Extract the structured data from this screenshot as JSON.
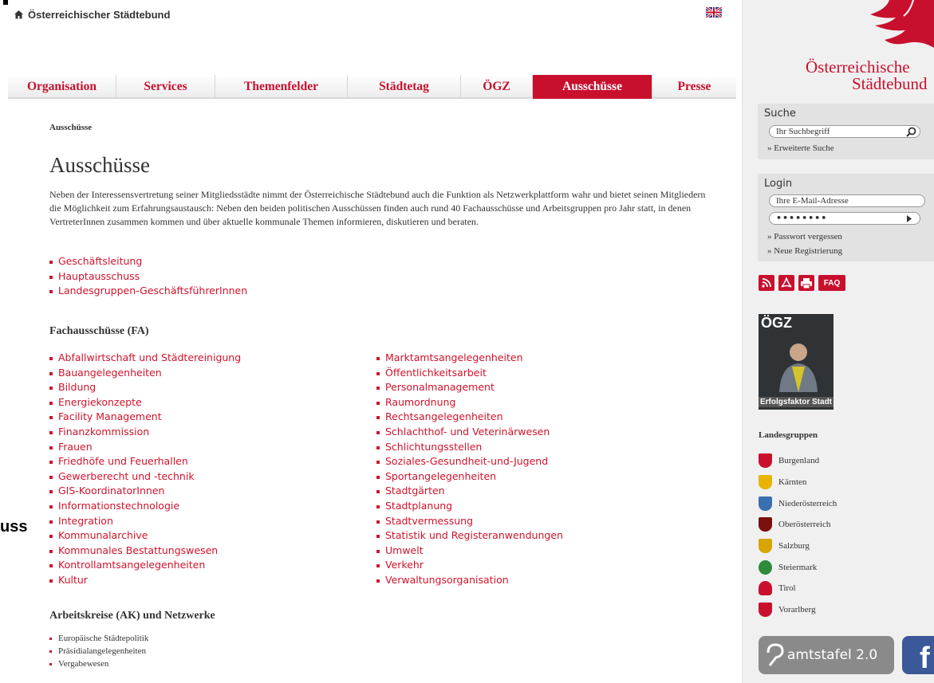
{
  "header": {
    "site_name": "Österreichischer Städtebund",
    "language_icon": "uk-flag-icon"
  },
  "nav": {
    "items": [
      "Organisation",
      "Services",
      "Themenfelder",
      "Städtetag",
      "ÖGZ",
      "Ausschüsse",
      "Presse"
    ],
    "active": "Ausschüsse"
  },
  "edge_fragment": "uss",
  "main": {
    "breadcrumb": "Ausschüsse",
    "title": "Ausschüsse",
    "intro": "Neben der Interessensvertretung seiner Mitgliedsstädte nimmt der Österreichische Städtebund auch die Funktion als Netzwerkplattform wahr und bietet seinen Mitgliedern die Möglichkeit zum Erfahrungsaustausch: Neben den beiden politischen Ausschüssen finden auch rund 40 Fachausschüsse und Arbeitsgruppen pro Jahr statt, in denen VertreterInnen zusammen kommen und über aktuelle kommunale Themen informieren, diskutieren und beraten.",
    "top_links": [
      "Geschäftsleitung",
      "Hauptausschuss",
      "Landesgruppen-GeschäftsführerInnen"
    ],
    "fa_title": "Fachausschüsse (FA)",
    "fa_col1": [
      "Abfallwirtschaft und Städtereinigung",
      "Bauangelegenheiten",
      "Bildung",
      "Energiekonzepte",
      "Facility Management",
      "Finanzkommission",
      "Frauen",
      "Friedhöfe und Feuerhallen",
      "Gewerberecht und -technik",
      "GIS-KoordinatorInnen",
      "Informationstechnologie",
      "Integration",
      "Kommunalarchive",
      "Kommunales Bestattungswesen",
      "Kontrollamtsangelegenheiten",
      "Kultur"
    ],
    "fa_col2": [
      "Marktamtsangelegenheiten",
      "Öffentlichkeitsarbeit",
      "Personalmanagement",
      "Raumordnung",
      "Rechtsangelegenheiten",
      "Schlachthof- und Veterinärwesen",
      "Schlichtungsstellen",
      "Soziales-Gesundheit-und-Jugend",
      "Sportangelegenheiten",
      "Stadtgärten",
      "Stadtplanung",
      "Stadtvermessung",
      "Statistik und Registeranwendungen",
      "Umwelt",
      "Verkehr",
      "Verwaltungsorganisation"
    ],
    "ak_title": "Arbeitskreise (AK) und Netzwerke",
    "ak_list": [
      "Europäische Städtepolitik",
      "Präsidialangelegenheiten",
      "Vergabewesen"
    ]
  },
  "sidebar": {
    "logo_line1": "Österreichische",
    "logo_line2": "Städtebund",
    "search": {
      "title": "Suche",
      "placeholder": "Ihr Suchbegriff",
      "advanced": "Erweiterte Suche"
    },
    "login": {
      "title": "Login",
      "email_placeholder": "Ihre E-Mail-Adresse",
      "password_mask": "••••••••",
      "forgot": "Passwort vergessen",
      "register": "Neue Registrierung"
    },
    "icons": [
      "rss-icon",
      "pdf-icon",
      "print-icon",
      "FAQ"
    ],
    "magazine": {
      "title": "ÖGZ",
      "caption": "Erfolgsfaktor Stadt"
    },
    "landesgruppen_title": "Landesgruppen",
    "landesgruppen": [
      {
        "name": "Burgenland",
        "color": "#c8102e"
      },
      {
        "name": "Kärnten",
        "color": "#e8b400"
      },
      {
        "name": "Niederösterreich",
        "color": "#3a6fb0"
      },
      {
        "name": "Oberösterreich",
        "color": "#7a1010"
      },
      {
        "name": "Salzburg",
        "color": "#d8a400"
      },
      {
        "name": "Steiermark",
        "color": "#2e8b3a"
      },
      {
        "name": "Tirol",
        "color": "#c8102e"
      },
      {
        "name": "Vorarlberg",
        "color": "#c8102e"
      }
    ],
    "amtstafel": "amtstafel 2.0",
    "facebook": "f"
  }
}
